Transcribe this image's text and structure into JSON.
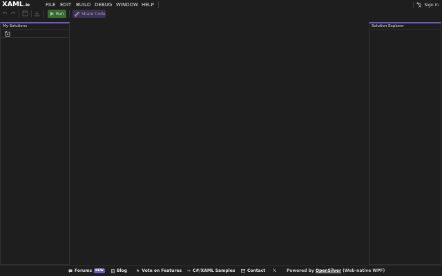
{
  "app": {
    "logo_text": "XAML",
    "logo_suffix": ".io"
  },
  "menu": {
    "items": [
      "FILE",
      "EDIT",
      "BUILD",
      "DEBUG",
      "WINDOW",
      "HELP"
    ],
    "sign_in": "Sign in"
  },
  "toolbar": {
    "run_label": "Run",
    "share_label": "Share Code"
  },
  "panels": {
    "left_title": "My Solutions",
    "right_title": "Solution Explorer"
  },
  "footer": {
    "forums": "Forums",
    "forums_badge": "NEW",
    "blog": "Blog",
    "vote": "Vote on Features",
    "samples": "C#/XAML Samples",
    "contact": "Contact",
    "x_icon": "𝕏",
    "powered_prefix": "Powered by",
    "powered_link": "OpenSilver",
    "powered_suffix": "(Web-native WPF)"
  },
  "colors": {
    "background": "#1e1e1e",
    "accent": "#6b5bc4",
    "run_green": "#3a6b35",
    "share_purple": "#3a3050"
  }
}
